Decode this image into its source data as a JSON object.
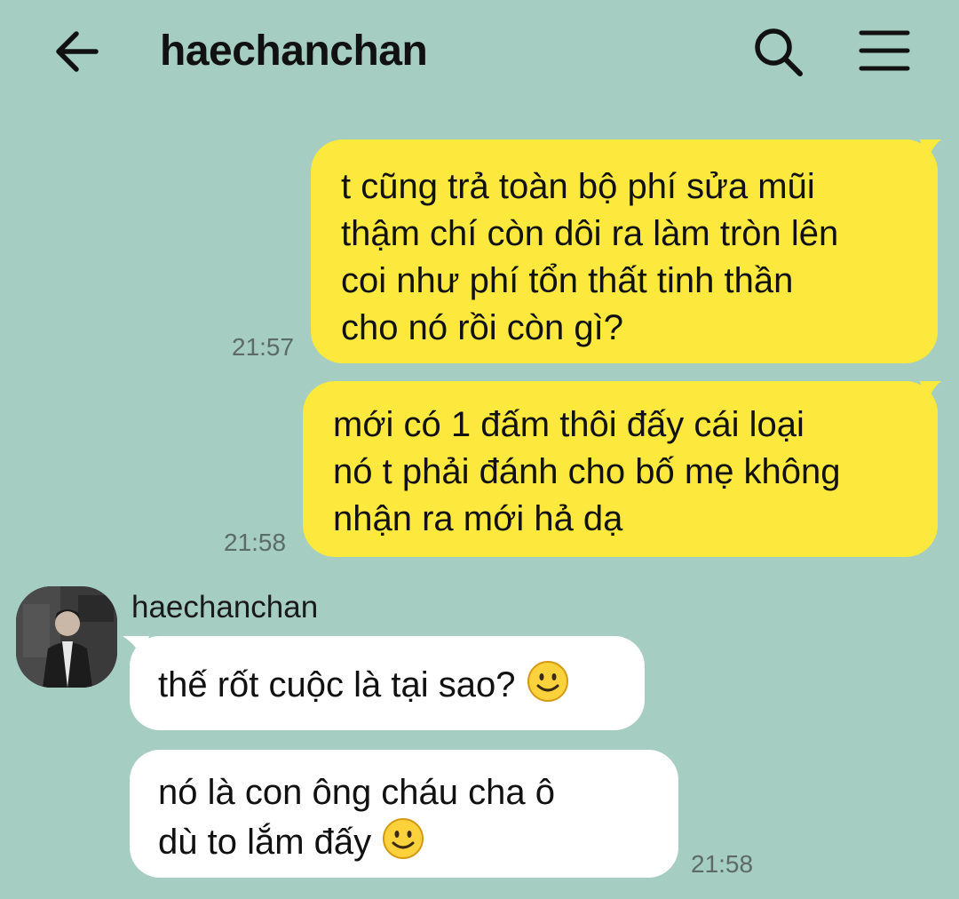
{
  "header": {
    "back_icon": "arrow-left-icon",
    "title": "haechanchan",
    "search_icon": "search-icon",
    "menu_icon": "hamburger-menu-icon"
  },
  "messages": [
    {
      "direction": "outgoing",
      "text": "t cũng trả toàn bộ phí sửa mũi\nthậm chí còn dôi ra làm tròn lên\ncoi như phí tổn thất tinh thần\ncho nó rồi còn gì?",
      "time": "21:57"
    },
    {
      "direction": "outgoing",
      "text": "mới có 1 đấm thôi đấy cái loại\nnó t phải đánh cho bố mẹ không\nnhận ra mới hả dạ",
      "time": "21:58"
    },
    {
      "direction": "incoming",
      "sender": "haechanchan",
      "text": "thế rốt cuộc là tại sao? ",
      "emoji": "smile-emoji"
    },
    {
      "direction": "incoming",
      "text": "nó là con ông cháu cha ô\ndù to lắm đấy ",
      "emoji": "smile-emoji",
      "time": "21:58"
    }
  ],
  "colors": {
    "background": "#a5cdc1",
    "outgoing_bubble": "#fde83e",
    "incoming_bubble": "#ffffff"
  }
}
